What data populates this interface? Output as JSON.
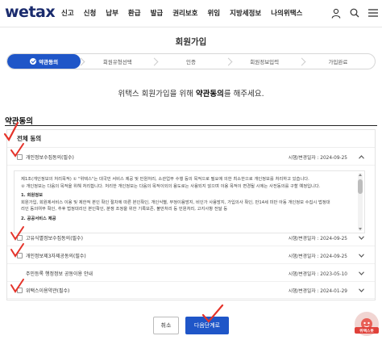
{
  "header": {
    "logo_we": "we",
    "logo_tax": "tax",
    "nav": [
      "신고",
      "신청",
      "납부",
      "환급",
      "발급",
      "권리보호",
      "위임",
      "지방세정보",
      "나의위택스"
    ]
  },
  "page_title": "회원가입",
  "steps": [
    "약관동의",
    "회원유형선택",
    "인증",
    "회원정보입력",
    "가입완료"
  ],
  "intro": {
    "before": "위택스 회원가입을 위해 ",
    "bold": "약관동의",
    "after": "를 해주세요."
  },
  "section_title": "약관동의",
  "all_agree_label": "전체 동의",
  "terms": [
    {
      "label": "개인정보수집동의(필수)",
      "date": "시행/변경일자 : 2024-09-25"
    },
    {
      "label": "고유식별정보수집동의(필수)",
      "date": "시행/변경일자 : 2024-09-25"
    },
    {
      "label": "개인정보제3자제공동의(필수)",
      "date": "시행/변경일자 : 2024-09-25"
    },
    {
      "label": "주민등록 행정정보 공동이용 안내",
      "date": "시행/변경일자 : 2023-05-10"
    },
    {
      "label": "위택스이용약관(필수)",
      "date": "시행/변경일자 : 2024-01-29"
    }
  ],
  "terms_text": {
    "p1": "제1조(개인정보의 처리목적) ① \"위택스\"는 대국민 서비스 제공 및 민원처리, 소관업무 수행 등의 목적으로 필요에 의한 최소한으로 개인정보를 처리하고 있습니다.",
    "p2": "② 개인정보는 다음의 목적을 위해 처리합니다. 처리한 개인정보는 다음의 목적이외의 용도로는 사용되지 않으며 이용 목적이 변경될 시에는 사전동의를 구할 예정입니다.",
    "head1": "1. 회원정보",
    "p3": "회원가입, 회원제서비스 이용 및 제한적 본인 확인 절차에 따른 본인확인, 개인식별, 부정이용방지, 비인가 사용방지, 가입의사 확인, 만14세 미만 아동 개인정보 수집시 법정대",
    "p4": "리인 동의여부 확인, 추후 법정대리인 본인확인, 분쟁 조정을 위한 기록보존, 불만처리 등 민원처리, 고지사항 전달 등",
    "head2": "2. 공공서비스 제공"
  },
  "buttons": {
    "cancel": "취소",
    "next": "다음단계로"
  },
  "helper_label": "위택스봇",
  "colors": {
    "brand": "#1a2b6d",
    "accent": "#1f56c8",
    "mark": "#e5332a"
  }
}
